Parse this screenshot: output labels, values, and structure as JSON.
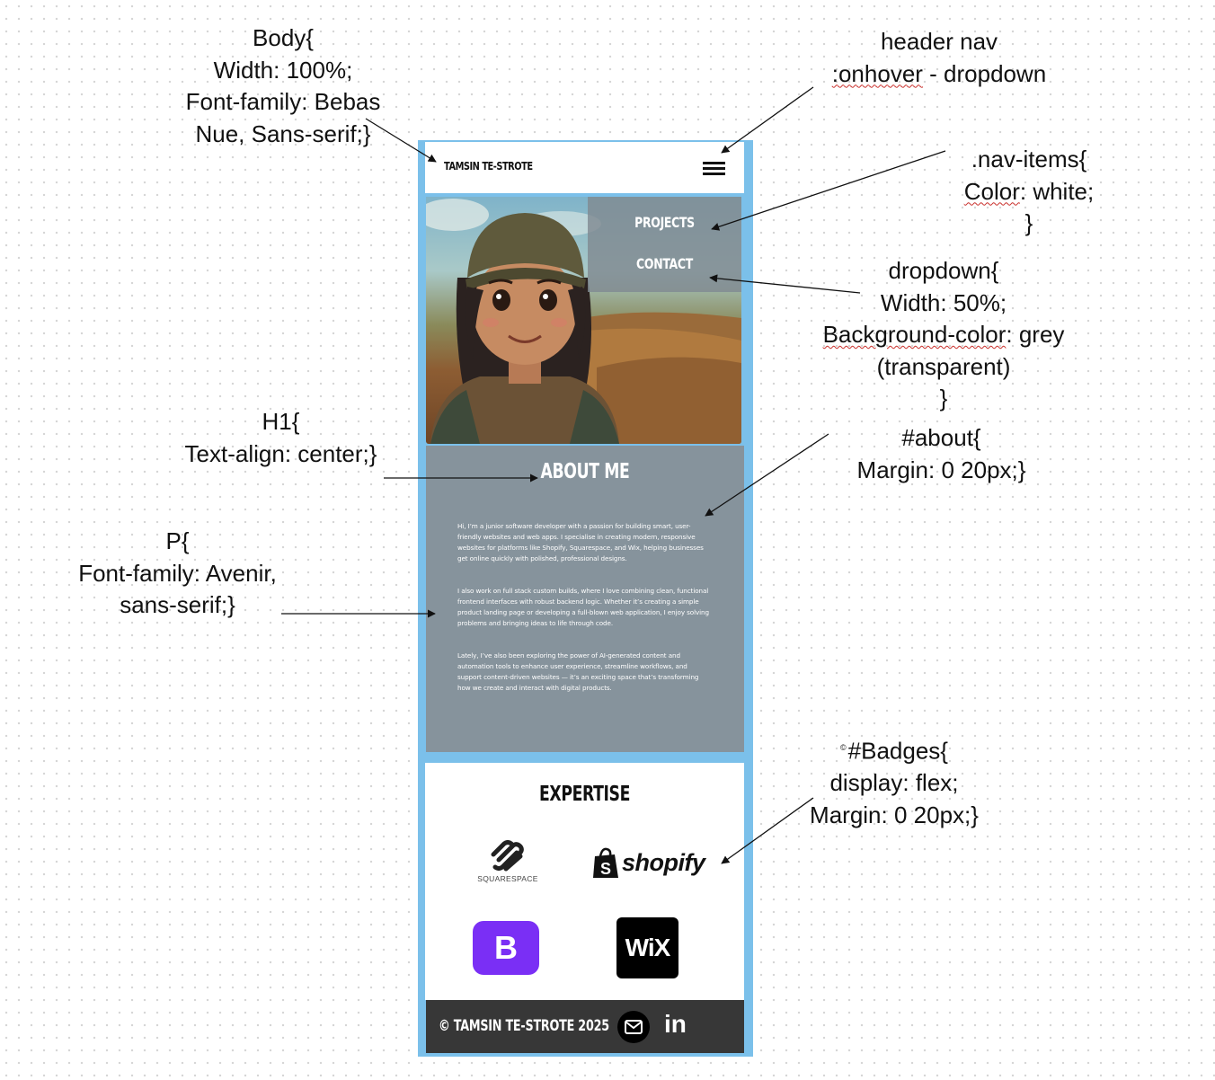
{
  "annotations": {
    "body": [
      "Body{",
      "Width: 100%;",
      "Font-family: Bebas",
      "Nue, Sans-serif;}"
    ],
    "header_nav": [
      "header nav",
      ":onhover",
      " - dropdown"
    ],
    "nav_items": [
      ".nav-items{",
      "Color",
      ": white;",
      "}"
    ],
    "dropdown": [
      "dropdown{",
      "Width: 50%;",
      "Background-color",
      ": grey",
      "(transparent)",
      "}"
    ],
    "h1": [
      "H1{",
      "Text-align: center;}"
    ],
    "about": [
      "#about{",
      "Margin: 0 20px;}"
    ],
    "p": [
      "P{",
      "Font-family: Avenir,",
      "sans-serif;}"
    ],
    "badges": [
      "©",
      "#Badges{",
      "display: flex;",
      "Margin: 0 20px;}"
    ]
  },
  "mockup": {
    "brand": "TAMSIN TE-STROTE",
    "nav_items": [
      "PROJECTS",
      "CONTACT"
    ],
    "about_title": "ABOUT ME",
    "about_paragraphs": [
      "Hi, I’m a junior software developer with a passion for building smart, user-friendly websites and web apps. I specialise in creating modern, responsive websites for platforms like Shopify, Squarespace, and Wix, helping businesses get online quickly with polished, professional designs.",
      "I also work on full stack custom builds, where I love combining clean, functional frontend interfaces with robust backend logic. Whether it’s creating a simple product landing page or developing a full-blown web application, I enjoy solving problems and bringing ideas to life through code.",
      "Lately, I’ve also been exploring the power of AI-generated content and automation tools to enhance user experience, streamline workflows, and support content-driven websites — it’s an exciting space that’s transforming how we create and interact with digital products."
    ],
    "expertise_title": "EXPERTISE",
    "badges": {
      "squarespace": "SQUARESPACE",
      "shopify": "shopify",
      "bootstrap": "B",
      "wix": "WiX"
    },
    "footer_copyright": "© TAMSIN TE-STROTE 2025",
    "linkedin": "in"
  },
  "colors": {
    "frame": "#7bc0ea",
    "about_bg": "#86939c",
    "dropdown_bg": "rgba(128,138,145,0.82)",
    "footer_bg": "#373737",
    "bootstrap": "#7a2ff5"
  },
  "icons": [
    "hamburger-menu-icon",
    "squarespace-logo-icon",
    "shopify-bag-icon",
    "mail-icon",
    "portrait-illustration"
  ]
}
